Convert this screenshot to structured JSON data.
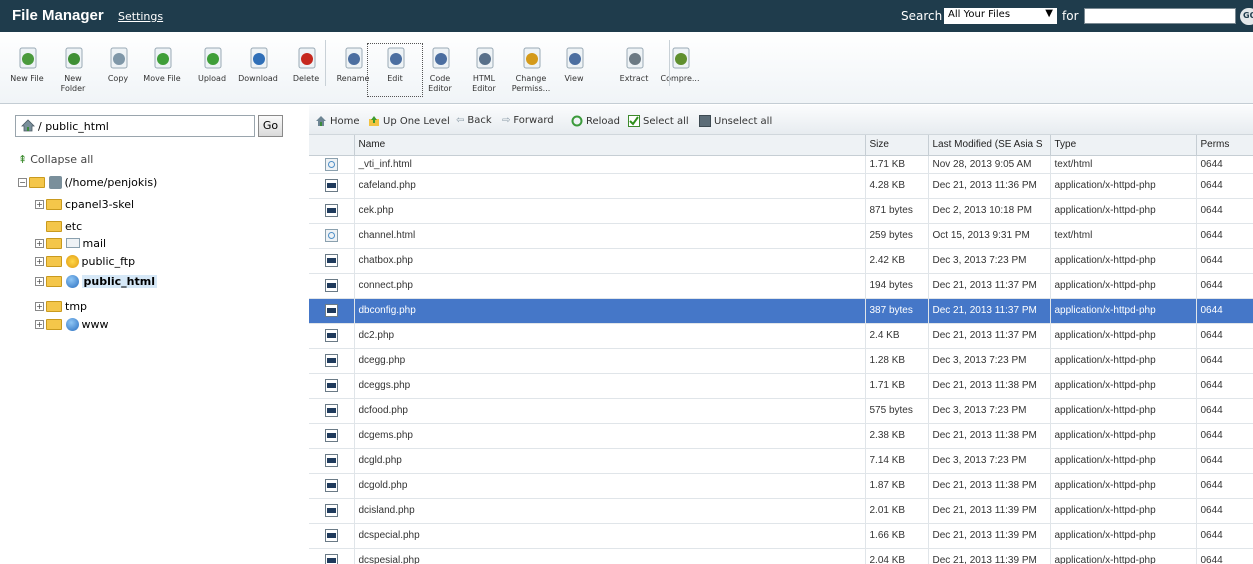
{
  "header": {
    "title": "File Manager",
    "settings": "Settings",
    "search_label": "Search",
    "search_scope": "All Your Files",
    "for_label": "for",
    "go": "GO"
  },
  "toolbar": [
    {
      "label": "New File",
      "icon": "new-file-icon"
    },
    {
      "label": "New Folder",
      "icon": "new-folder-icon"
    },
    {
      "label": "Copy",
      "icon": "copy-icon"
    },
    {
      "label": "Move File",
      "icon": "move-file-icon"
    },
    {
      "label": "Upload",
      "icon": "upload-icon"
    },
    {
      "label": "Download",
      "icon": "download-icon"
    },
    {
      "label": "Delete",
      "icon": "delete-icon"
    },
    {
      "label": "Rename",
      "icon": "rename-icon"
    },
    {
      "label": "Edit",
      "icon": "edit-icon"
    },
    {
      "label": "Code Editor",
      "icon": "code-editor-icon"
    },
    {
      "label": "HTML Editor",
      "icon": "html-editor-icon"
    },
    {
      "label": "Change Permiss...",
      "icon": "permissions-icon"
    },
    {
      "label": "View",
      "icon": "view-icon"
    },
    {
      "label": "Extract",
      "icon": "extract-icon"
    },
    {
      "label": "Compre...",
      "icon": "compress-icon"
    }
  ],
  "left": {
    "path": "/ public_html",
    "go_button": "Go",
    "collapse_all": "Collapse all",
    "tree": [
      {
        "label": "(/home/penjokis)",
        "type": "home"
      },
      {
        "label": "cpanel3-skel",
        "type": "folder"
      },
      {
        "label": "etc",
        "type": "folder"
      },
      {
        "label": "mail",
        "type": "mail"
      },
      {
        "label": "public_ftp",
        "type": "ftp"
      },
      {
        "label": "public_html",
        "type": "globe",
        "active": true
      },
      {
        "label": "tmp",
        "type": "folder"
      },
      {
        "label": "www",
        "type": "globe"
      }
    ]
  },
  "nav": {
    "home": "Home",
    "up": "Up One Level",
    "back": "Back",
    "forward": "Forward",
    "reload": "Reload",
    "select_all": "Select all",
    "unselect_all": "Unselect all"
  },
  "columns": {
    "name": "Name",
    "size": "Size",
    "modified": "Last Modified (SE Asia S",
    "type": "Type",
    "perms": "Perms"
  },
  "files": [
    {
      "icon": "html",
      "name": "_vti_inf.html",
      "size": "1.71 KB",
      "modified": "Nov 28, 2013 9:05 AM",
      "type": "text/html",
      "perms": "0644"
    },
    {
      "icon": "php",
      "name": "cafeland.php",
      "size": "4.28 KB",
      "modified": "Dec 21, 2013 11:36 PM",
      "type": "application/x-httpd-php",
      "perms": "0644"
    },
    {
      "icon": "php",
      "name": "cek.php",
      "size": "871 bytes",
      "modified": "Dec 2, 2013 10:18 PM",
      "type": "application/x-httpd-php",
      "perms": "0644"
    },
    {
      "icon": "html",
      "name": "channel.html",
      "size": "259 bytes",
      "modified": "Oct 15, 2013 9:31 PM",
      "type": "text/html",
      "perms": "0644"
    },
    {
      "icon": "php",
      "name": "chatbox.php",
      "size": "2.42 KB",
      "modified": "Dec 3, 2013 7:23 PM",
      "type": "application/x-httpd-php",
      "perms": "0644"
    },
    {
      "icon": "php",
      "name": "connect.php",
      "size": "194 bytes",
      "modified": "Dec 21, 2013 11:37 PM",
      "type": "application/x-httpd-php",
      "perms": "0644"
    },
    {
      "icon": "php",
      "name": "dbconfig.php",
      "size": "387 bytes",
      "modified": "Dec 21, 2013 11:37 PM",
      "type": "application/x-httpd-php",
      "perms": "0644",
      "selected": true
    },
    {
      "icon": "php",
      "name": "dc2.php",
      "size": "2.4 KB",
      "modified": "Dec 21, 2013 11:37 PM",
      "type": "application/x-httpd-php",
      "perms": "0644"
    },
    {
      "icon": "php",
      "name": "dcegg.php",
      "size": "1.28 KB",
      "modified": "Dec 3, 2013 7:23 PM",
      "type": "application/x-httpd-php",
      "perms": "0644"
    },
    {
      "icon": "php",
      "name": "dceggs.php",
      "size": "1.71 KB",
      "modified": "Dec 21, 2013 11:38 PM",
      "type": "application/x-httpd-php",
      "perms": "0644"
    },
    {
      "icon": "php",
      "name": "dcfood.php",
      "size": "575 bytes",
      "modified": "Dec 3, 2013 7:23 PM",
      "type": "application/x-httpd-php",
      "perms": "0644"
    },
    {
      "icon": "php",
      "name": "dcgems.php",
      "size": "2.38 KB",
      "modified": "Dec 21, 2013 11:38 PM",
      "type": "application/x-httpd-php",
      "perms": "0644"
    },
    {
      "icon": "php",
      "name": "dcgld.php",
      "size": "7.14 KB",
      "modified": "Dec 3, 2013 7:23 PM",
      "type": "application/x-httpd-php",
      "perms": "0644"
    },
    {
      "icon": "php",
      "name": "dcgold.php",
      "size": "1.87 KB",
      "modified": "Dec 21, 2013 11:38 PM",
      "type": "application/x-httpd-php",
      "perms": "0644"
    },
    {
      "icon": "php",
      "name": "dcisland.php",
      "size": "2.01 KB",
      "modified": "Dec 21, 2013 11:39 PM",
      "type": "application/x-httpd-php",
      "perms": "0644"
    },
    {
      "icon": "php",
      "name": "dcspecial.php",
      "size": "1.66 KB",
      "modified": "Dec 21, 2013 11:39 PM",
      "type": "application/x-httpd-php",
      "perms": "0644"
    },
    {
      "icon": "php",
      "name": "dcspesial.php",
      "size": "2.04 KB",
      "modified": "Dec 21, 2013 11:39 PM",
      "type": "application/x-httpd-php",
      "perms": "0644"
    }
  ]
}
